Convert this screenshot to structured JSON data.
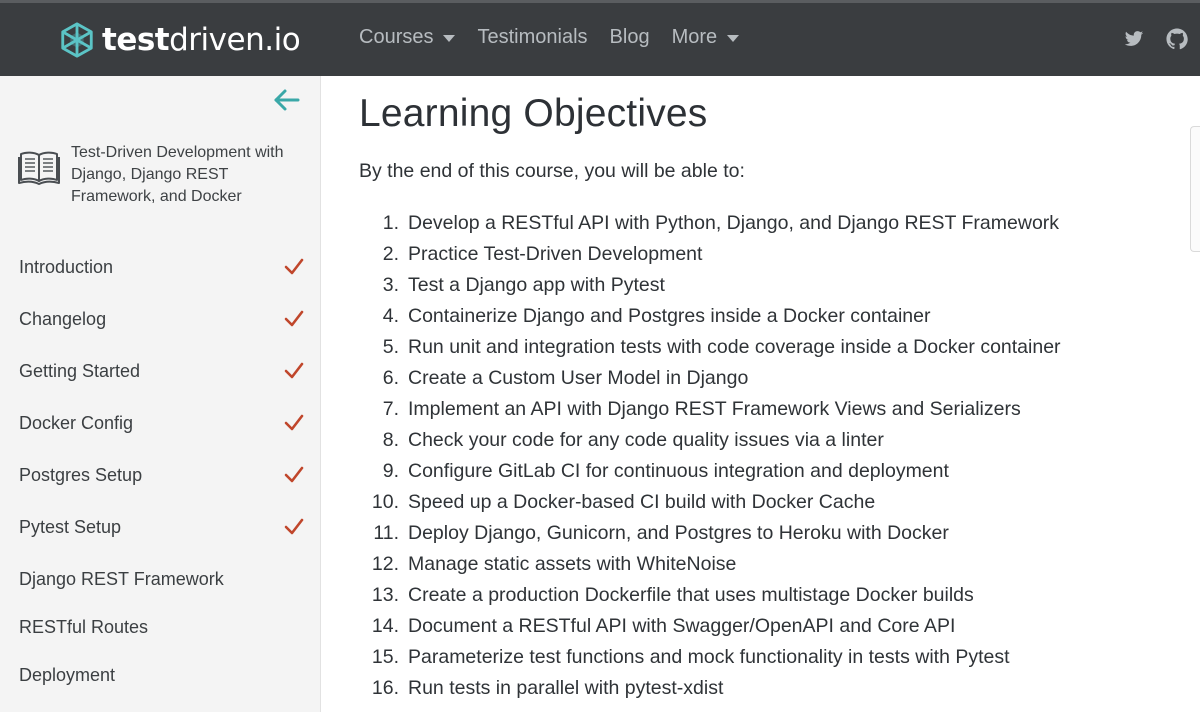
{
  "navbar": {
    "brand": {
      "bold": "test",
      "regular": "driven.io"
    },
    "items": [
      {
        "label": "Courses",
        "dropdown": true
      },
      {
        "label": "Testimonials",
        "dropdown": false
      },
      {
        "label": "Blog",
        "dropdown": false
      },
      {
        "label": "More",
        "dropdown": true
      }
    ],
    "icons": [
      "twitter-icon",
      "github-icon"
    ],
    "background": "#3a3d40",
    "logo_color": "#5bc4c6"
  },
  "sidebar": {
    "back_icon": "arrow-left-icon",
    "course_icon": "book-icon",
    "course_title": "Test-Driven Development with Django, Django REST Framework, and Docker",
    "chapters": [
      {
        "label": "Introduction",
        "completed": true
      },
      {
        "label": "Changelog",
        "completed": true
      },
      {
        "label": "Getting Started",
        "completed": true
      },
      {
        "label": "Docker Config",
        "completed": true
      },
      {
        "label": "Postgres Setup",
        "completed": true
      },
      {
        "label": "Pytest Setup",
        "completed": true
      },
      {
        "label": "Django REST Framework",
        "completed": false
      },
      {
        "label": "RESTful Routes",
        "completed": false
      },
      {
        "label": "Deployment",
        "completed": false
      }
    ],
    "check_color": "#c0462b",
    "accent_color": "#3aa8a8"
  },
  "main": {
    "title": "Learning Objectives",
    "intro": "By the end of this course, you will be able to:",
    "objectives": [
      {
        "num": "1.",
        "text": "Develop a RESTful API with Python, Django, and Django REST Framework"
      },
      {
        "num": "2.",
        "text": "Practice Test-Driven Development"
      },
      {
        "num": "3.",
        "text": "Test a Django app with Pytest"
      },
      {
        "num": "4.",
        "text": "Containerize Django and Postgres inside a Docker container"
      },
      {
        "num": "5.",
        "text": "Run unit and integration tests with code coverage inside a Docker container"
      },
      {
        "num": "6.",
        "text": "Create a Custom User Model in Django"
      },
      {
        "num": "7.",
        "text": "Implement an API with Django REST Framework Views and Serializers"
      },
      {
        "num": "8.",
        "text": "Check your code for any code quality issues via a linter"
      },
      {
        "num": "9.",
        "text": "Configure GitLab CI for continuous integration and deployment"
      },
      {
        "num": "10.",
        "text": "Speed up a Docker-based CI build with Docker Cache"
      },
      {
        "num": "11.",
        "text": "Deploy Django, Gunicorn, and Postgres to Heroku with Docker"
      },
      {
        "num": "12.",
        "text": "Manage static assets with WhiteNoise"
      },
      {
        "num": "13.",
        "text": "Create a production Dockerfile that uses multistage Docker builds"
      },
      {
        "num": "14.",
        "text": "Document a RESTful API with Swagger/OpenAPI and Core API"
      },
      {
        "num": "15.",
        "text": "Parameterize test functions and mock functionality in tests with Pytest"
      },
      {
        "num": "16.",
        "text": "Run tests in parallel with pytest-xdist"
      }
    ]
  }
}
